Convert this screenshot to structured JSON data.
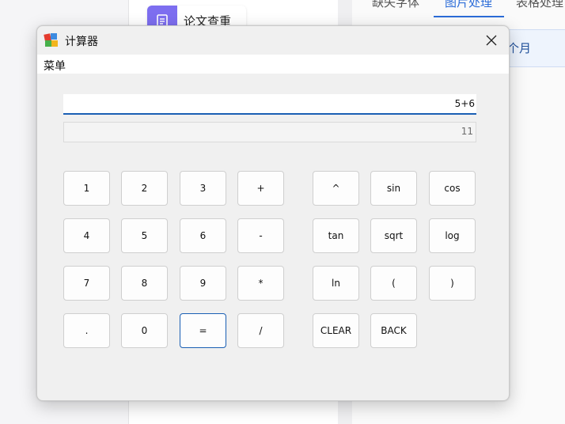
{
  "background": {
    "card_label": "论文查重",
    "tabs": [
      "缺失字体",
      "图片处理",
      "表格处理"
    ],
    "panel_label": "个月"
  },
  "window": {
    "title": "计算器",
    "menu": "菜单"
  },
  "calculator": {
    "expression": "5+6",
    "result": "11",
    "buttons_left": [
      [
        "1",
        "2",
        "3",
        "+"
      ],
      [
        "4",
        "5",
        "6",
        "-"
      ],
      [
        "7",
        "8",
        "9",
        "*"
      ],
      [
        ".",
        "0",
        "=",
        "/"
      ]
    ],
    "buttons_right": [
      [
        "^",
        "sin",
        "cos"
      ],
      [
        "tan",
        "sqrt",
        "log"
      ],
      [
        "ln",
        "(",
        ")"
      ],
      [
        "CLEAR",
        "BACK"
      ]
    ]
  },
  "colors": {
    "accent": "#1a5fb4",
    "app_accent": "#2b6cd8"
  }
}
